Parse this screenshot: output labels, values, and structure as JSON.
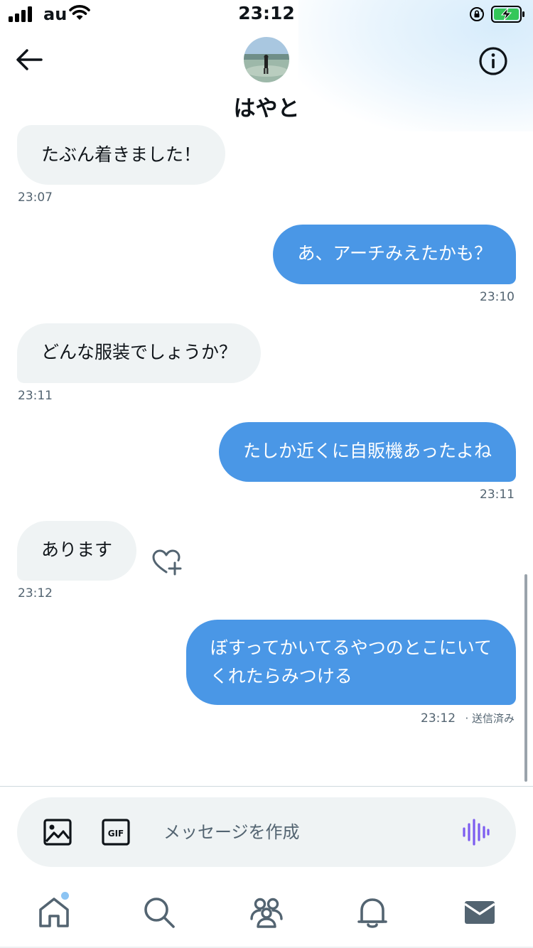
{
  "status_bar": {
    "carrier": "au",
    "time": "23:12",
    "battery_state": "charging",
    "icons": [
      "signal-icon",
      "wifi-icon",
      "rotation-lock-icon",
      "battery-charging-icon"
    ]
  },
  "header": {
    "title": "はやと",
    "back_icon": "arrow-left-icon",
    "info_icon": "info-icon"
  },
  "messages": [
    {
      "direction": "received",
      "text": "たぶん着きました！",
      "time": "23:07"
    },
    {
      "direction": "sent",
      "text": "あ、アーチみえたかも？",
      "time": "23:10"
    },
    {
      "direction": "received",
      "text": "どんな服装でしょうか？",
      "time": "23:11"
    },
    {
      "direction": "sent",
      "text": "たしか近くに自販機あったよね",
      "time": "23:11"
    },
    {
      "direction": "received",
      "text": "あります",
      "time": "23:12"
    },
    {
      "direction": "sent",
      "text_line1": "ぼすってかいてるやつのとこにいて",
      "text_line2": "くれたらみつける",
      "time": "23:12",
      "status": "· 送信済み"
    }
  ],
  "composer": {
    "placeholder": "メッセージを作成",
    "icons": [
      "image-icon",
      "gif-icon",
      "voice-message-icon"
    ]
  },
  "bottom_nav": {
    "items": [
      "home-icon",
      "search-icon",
      "communities-icon",
      "notifications-icon",
      "messages-icon"
    ],
    "active": "messages-icon",
    "home_badge": true
  },
  "colors": {
    "sent_bubble": "#4a97e6",
    "received_bubble": "#eff3f4",
    "text": "#0f1419",
    "muted": "#536471",
    "voice_accent": "#7c5cf0"
  }
}
